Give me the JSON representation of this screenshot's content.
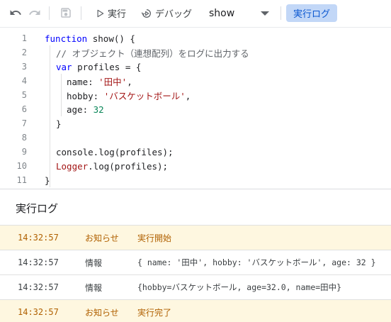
{
  "toolbar": {
    "run_label": "実行",
    "debug_label": "デバッグ",
    "function_selected": "show",
    "log_label": "実行ログ"
  },
  "editor": {
    "line_numbers": [
      "1",
      "2",
      "3",
      "4",
      "5",
      "6",
      "7",
      "8",
      "9",
      "10",
      "11"
    ],
    "lines": {
      "l1_kw": "function",
      "l1_rest": " show() {",
      "l2_comment": "// オブジェクト（連想配列）をログに出力する",
      "l3_kw": "var",
      "l3_rest": " profiles = {",
      "l4_key": "name: ",
      "l4_val": "'田中'",
      "l4_end": ",",
      "l5_key": "hobby: ",
      "l5_val": "'バスケットボール'",
      "l5_end": ",",
      "l6_key": "age: ",
      "l6_val": "32",
      "l7": "}",
      "l9": "console.log(profiles);",
      "l10_cls": "Logger",
      "l10_rest": ".log(profiles);",
      "l11": "}"
    }
  },
  "log": {
    "title": "実行ログ",
    "rows": [
      {
        "time": "14:32:57",
        "level": "お知らせ",
        "message": "実行開始"
      },
      {
        "time": "14:32:57",
        "level": "情報",
        "message": "{ name: '田中', hobby: 'バスケットボール', age: 32 }"
      },
      {
        "time": "14:32:57",
        "level": "情報",
        "message": "{hobby=バスケットボール, age=32.0, name=田中}"
      },
      {
        "time": "14:32:57",
        "level": "お知らせ",
        "message": "実行完了"
      }
    ]
  },
  "icons": {
    "undo": "undo-icon",
    "redo": "redo-icon",
    "save": "save-icon",
    "run": "play-icon",
    "debug": "debug-icon",
    "dropdown": "caret-down-icon"
  },
  "colors": {
    "log_button_bg": "#c2d7f7",
    "log_button_text": "#0b57d0",
    "notice_row_bg": "#fef7e0",
    "notice_text": "#b06000"
  }
}
